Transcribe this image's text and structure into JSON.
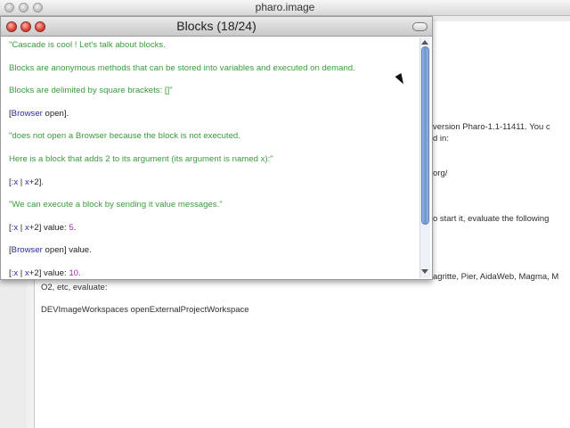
{
  "main_window": {
    "title": "pharo.image"
  },
  "workspace": {
    "lines": [
      "version Pharo-1.1-11411. You c",
      "d in:",
      "org/",
      "o start it, evaluate the following",
      "agritte, Pier, AidaWeb, Magma, M",
      "O2, etc, evaluate:",
      "DEVImageWorkspaces openExternalProjectWorkspace"
    ]
  },
  "blocks_window": {
    "title": "Blocks (18/24)",
    "lines": [
      {
        "parts": [
          {
            "text": "\"Cascade is cool ! Let's talk about blocks.",
            "color": "green"
          }
        ]
      },
      {
        "parts": [
          {
            "text": "Blocks are anonymous methods that can be stored into variables and executed on demand.",
            "color": "green"
          }
        ]
      },
      {
        "parts": [
          {
            "text": "Blocks are delimited by square brackets: []\"",
            "color": "green"
          }
        ]
      },
      {
        "parts": [
          {
            "text": "[",
            "color": "black"
          },
          {
            "text": "Browser",
            "color": "blue"
          },
          {
            "text": " open].",
            "color": "black"
          }
        ]
      },
      {
        "parts": [
          {
            "text": "\"does not open a Browser because the block is not executed.",
            "color": "green"
          }
        ]
      },
      {
        "parts": [
          {
            "text": "Here is a block that adds 2 to its argument (its argument is named x):\"",
            "color": "green"
          }
        ]
      },
      {
        "parts": [
          {
            "text": "[",
            "color": "black"
          },
          {
            "text": ":x",
            "color": "blue"
          },
          {
            "text": " | ",
            "color": "black"
          },
          {
            "text": "x",
            "color": "blue"
          },
          {
            "text": "+2].",
            "color": "black"
          }
        ]
      },
      {
        "parts": [
          {
            "text": "\"We can execute a block by sending it value messages.\"",
            "color": "green"
          }
        ]
      },
      {
        "parts": [
          {
            "text": "[",
            "color": "black"
          },
          {
            "text": ":x",
            "color": "blue"
          },
          {
            "text": " | ",
            "color": "black"
          },
          {
            "text": "x",
            "color": "blue"
          },
          {
            "text": "+2] value: ",
            "color": "black"
          },
          {
            "text": "5",
            "color": "purple"
          },
          {
            "text": ".",
            "color": "black"
          }
        ]
      },
      {
        "parts": [
          {
            "text": "[",
            "color": "black"
          },
          {
            "text": "Browser",
            "color": "blue"
          },
          {
            "text": " open] value.",
            "color": "black"
          }
        ]
      },
      {
        "parts": [
          {
            "text": "[",
            "color": "black"
          },
          {
            "text": ":x",
            "color": "blue"
          },
          {
            "text": " | ",
            "color": "black"
          },
          {
            "text": "x",
            "color": "blue"
          },
          {
            "text": "+2] value: ",
            "color": "black"
          },
          {
            "text": "10",
            "color": "purple"
          },
          {
            "text": ".",
            "color": "black"
          }
        ]
      }
    ]
  },
  "colors": {
    "green": "#3a9c3a",
    "blue": "#2b2ba8",
    "black": "#222222",
    "purple": "#a02ca8"
  }
}
